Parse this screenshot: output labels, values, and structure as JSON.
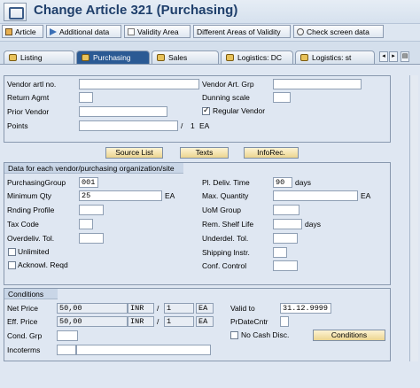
{
  "window": {
    "title": "Change Article 321 (Purchasing)"
  },
  "toolbar": {
    "article": "Article",
    "additional_data": "Additional data",
    "validity_area": "Validity Area",
    "different_areas": "Different Areas of Validity",
    "check_screen": "Check screen data"
  },
  "tabs": {
    "listing": "Listing",
    "purchasing": "Purchasing",
    "sales": "Sales",
    "logistics_dc": "Logistics: DC",
    "logistics_st": "Logistics: st"
  },
  "vendor": {
    "vendor_artl_no_label": "Vendor artl no.",
    "return_agmt_label": "Return Agmt",
    "prior_vendor_label": "Prior Vendor",
    "points_label": "Points",
    "points_sep": "/",
    "points_qty": "1",
    "points_unit": "EA",
    "vendor_art_grp_label": "Vendor Art. Grp",
    "dunning_scale_label": "Dunning scale",
    "regular_vendor_label": "Regular Vendor",
    "regular_vendor_checked": true
  },
  "buttons": {
    "source_list": "Source List",
    "texts": "Texts",
    "inforec": "InfoRec."
  },
  "porg": {
    "header": "Data for each vendor/purchasing organization/site",
    "purch_group_label": "PurchasingGroup",
    "purch_group_value": "001",
    "min_qty_label": "Minimum Qty",
    "min_qty_value": "25",
    "min_qty_unit": "EA",
    "rnding_profile_label": "Rnding Profile",
    "tax_code_label": "Tax Code",
    "overdeliv_label": "Overdeliv. Tol.",
    "unlimited_label": "Unlimited",
    "acknowl_label": "Acknowl. Reqd",
    "pl_deliv_time_label": "Pl. Deliv. Time",
    "pl_deliv_time_value": "90",
    "pl_deliv_time_unit": "days",
    "max_qty_label": "Max. Quantity",
    "max_qty_unit": "EA",
    "uom_group_label": "UoM Group",
    "shelf_life_label": "Rem. Shelf Life",
    "shelf_life_unit": "days",
    "underdel_label": "Underdel. Tol.",
    "shipping_label": "Shipping Instr.",
    "conf_control_label": "Conf. Control"
  },
  "conditions": {
    "header": "Conditions",
    "net_price_label": "Net Price",
    "net_price_value": "50,00",
    "net_price_curr": "INR",
    "net_price_per": "1",
    "net_price_unit": "EA",
    "eff_price_label": "Eff. Price",
    "eff_price_value": "50,00",
    "eff_price_curr": "INR",
    "eff_price_per": "1",
    "eff_price_unit": "EA",
    "cond_grp_label": "Cond. Grp",
    "incoterms_label": "Incoterms",
    "valid_to_label": "Valid to",
    "valid_to_value": "31.12.9999",
    "pr_date_cntr_label": "PrDateCntr",
    "no_cash_disc_label": "No Cash Disc.",
    "conditions_button": "Conditions",
    "sep": "/"
  }
}
